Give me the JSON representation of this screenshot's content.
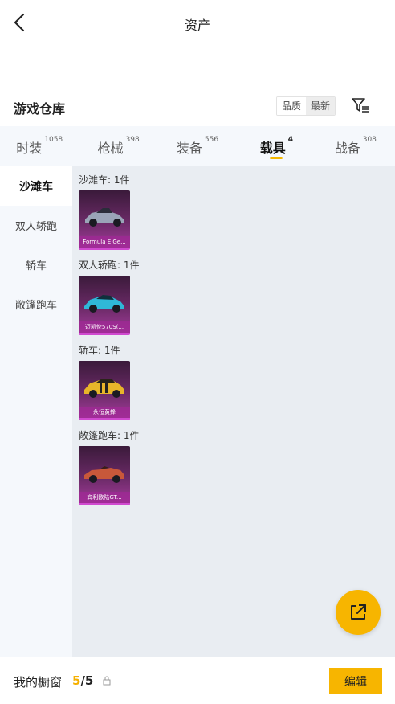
{
  "header": {
    "title": "资产"
  },
  "section": {
    "title": "游戏仓库"
  },
  "sort": {
    "options": [
      "品质",
      "最新"
    ]
  },
  "tabs": [
    {
      "label": "时装",
      "count": "1058"
    },
    {
      "label": "枪械",
      "count": "398"
    },
    {
      "label": "装备",
      "count": "556"
    },
    {
      "label": "载具",
      "count": "4"
    },
    {
      "label": "战备",
      "count": "308"
    }
  ],
  "sidebar": {
    "items": [
      "沙滩车",
      "双人轿跑",
      "轿车",
      "敞篷跑车"
    ]
  },
  "groups": [
    {
      "title": "沙滩车: 1件",
      "item_name": "Formula E Ge...",
      "car_color": "#9aa4b8"
    },
    {
      "title": "双人轿跑: 1件",
      "item_name": "迈凯伦570S(...",
      "car_color": "#2fb8d8"
    },
    {
      "title": "轿车: 1件",
      "item_name": "永恒黄蜂",
      "car_color": "#e8b52a"
    },
    {
      "title": "敞篷跑车: 1件",
      "item_name": "宾利欧陆GT...",
      "car_color": "#c8583a"
    }
  ],
  "bottom": {
    "showcase_label": "我的橱窗",
    "current": "5",
    "separator": "/",
    "total": "5",
    "edit_label": "编辑"
  },
  "colors": {
    "accent": "#f7b500",
    "card_rarity": "#a03a98"
  },
  "icons": {
    "back": "chevron-left-icon",
    "filter": "filter-icon",
    "share": "share-out-icon",
    "lock": "lock-icon"
  }
}
